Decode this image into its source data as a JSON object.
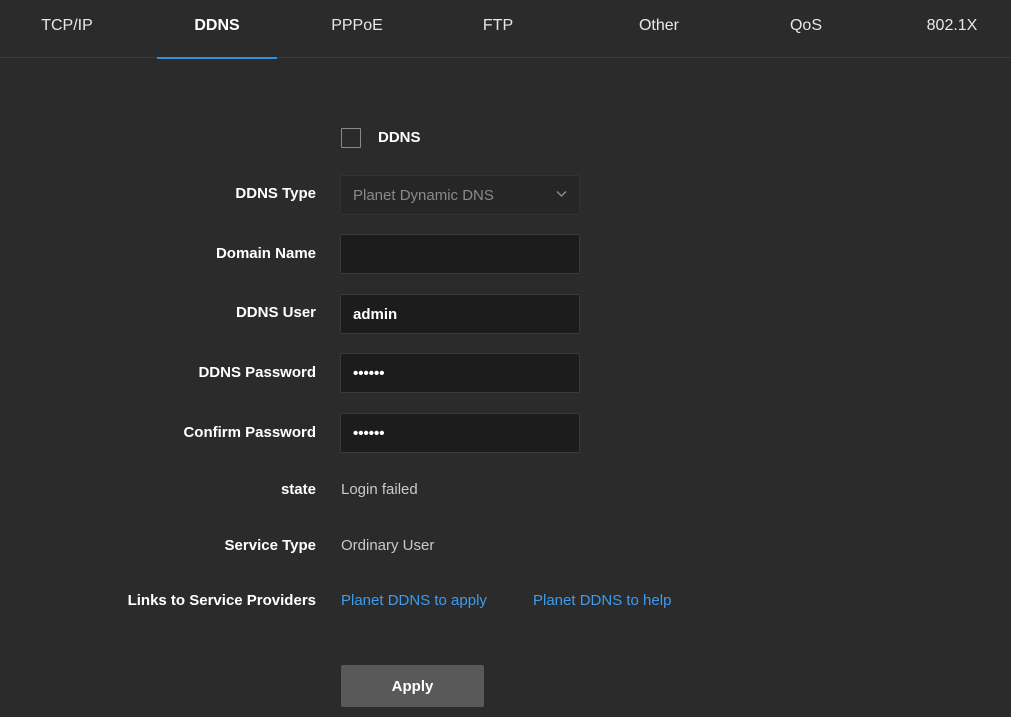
{
  "tabs": {
    "tcpip": "TCP/IP",
    "ddns": "DDNS",
    "pppoe": "PPPoE",
    "ftp": "FTP",
    "other": "Other",
    "qos": "QoS",
    "dot1x": "802.1X",
    "active": "DDNS"
  },
  "form": {
    "enable_label": "DDNS",
    "enable_checked": false,
    "type_label": "DDNS Type",
    "type_value": "Planet Dynamic DNS",
    "domain_label": "Domain Name",
    "domain_value": "",
    "user_label": "DDNS User",
    "user_value": "admin",
    "password_label": "DDNS Password",
    "password_value": "••••••",
    "confirm_label": "Confirm Password",
    "confirm_value": "••••••",
    "state_label": "state",
    "state_value": "Login failed",
    "service_type_label": "Service Type",
    "service_type_value": "Ordinary User",
    "links_label": "Links to Service Providers",
    "link_apply": "Planet DDNS to apply",
    "link_help": "Planet DDNS to help",
    "apply_button": "Apply"
  },
  "icons": {
    "dropdown": "chevron-down-icon",
    "checkbox": "checkbox-unchecked"
  },
  "colors": {
    "background": "#2b2b2b",
    "accent": "#2f8fe3",
    "link": "#3d9cf0",
    "button": "#595959"
  }
}
